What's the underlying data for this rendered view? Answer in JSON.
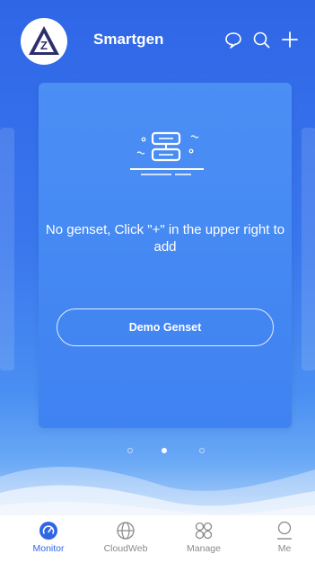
{
  "header": {
    "brand": "Smartgen",
    "icons": {
      "avatar": "smartgen-logo-icon",
      "chat": "chat-bubble-icon",
      "search": "search-icon",
      "add": "plus-icon"
    }
  },
  "card": {
    "empty_message": "No genset, Click \"+\" in the upper right to add",
    "demo_button": "Demo Genset",
    "illustration": "empty-server-icon"
  },
  "pager": {
    "count": 3,
    "active": 2
  },
  "tabs": [
    {
      "label": "Monitor",
      "icon": "monitor-gauge-icon",
      "active": true
    },
    {
      "label": "CloudWeb",
      "icon": "globe-icon",
      "active": false
    },
    {
      "label": "Manage",
      "icon": "grid-icon",
      "active": false
    },
    {
      "label": "Me",
      "icon": "user-icon",
      "active": false
    }
  ],
  "colors": {
    "primary": "#2f66e6",
    "card": "#4b8ff5",
    "tab_active": "#2f66e6",
    "tab_inactive": "#8a8a8a"
  }
}
